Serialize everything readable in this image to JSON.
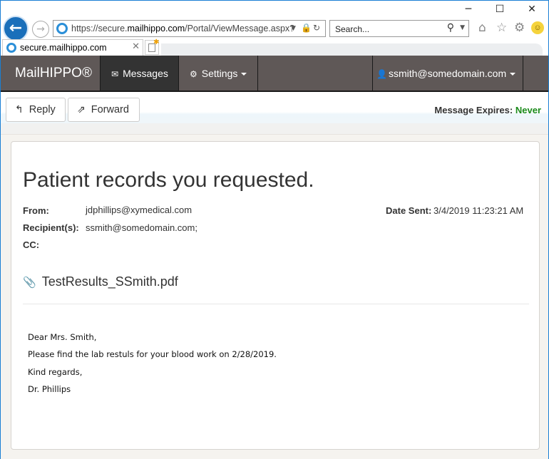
{
  "browser": {
    "url_prefix": "https://secure.",
    "url_domain": "mailhippo.com",
    "url_path": "/Portal/ViewMessage.aspx?",
    "search_placeholder": "Search...",
    "tab_title": "secure.mailhippo.com",
    "icons": [
      "back-icon",
      "forward-icon",
      "ie-icon",
      "lock-icon",
      "refresh-icon",
      "search-icon",
      "home-icon",
      "star-icon",
      "gear-icon",
      "smiley-icon"
    ]
  },
  "nav": {
    "brand": "MailHIPPO®",
    "messages": "Messages",
    "settings": "Settings",
    "user": "ssmith@somedomain.com"
  },
  "toolbar": {
    "reply": "Reply",
    "forward": "Forward",
    "expires_label": "Message Expires:",
    "expires_value": "Never"
  },
  "message": {
    "subject": "Patient records you requested.",
    "from_label": "From:",
    "from": "jdphillips@xymedical.com",
    "recipients_label": "Recipient(s):",
    "recipients": "ssmith@somedomain.com;",
    "cc_label": "CC:",
    "cc": "",
    "date_label": "Date Sent:",
    "date": "3/4/2019 11:23:21 AM",
    "attachment": "TestResults_SSmith.pdf",
    "body": [
      "Dear Mrs. Smith,",
      "Please find the lab restuls for your blood work on 2/28/2019.",
      "Kind regards,",
      "Dr. Phillips"
    ]
  },
  "colors": {
    "navbar": "#5f5857",
    "active_nav": "#333333",
    "never": "#1a8a1a"
  }
}
